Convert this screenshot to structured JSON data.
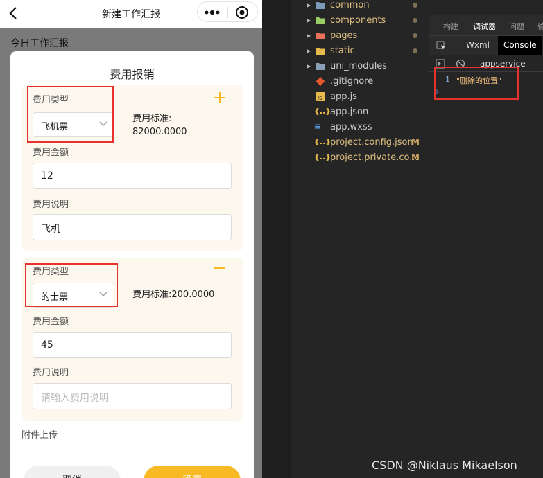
{
  "phone": {
    "nav_title": "新建工作汇报",
    "behind_title": "今日工作汇报",
    "modal": {
      "title": "费用报销",
      "items": [
        {
          "type_label": "费用类型",
          "type_value": "飞机票",
          "standard_label": "费用标准:",
          "standard_value": "82000.0000",
          "amount_label": "费用金额",
          "amount_value": "12",
          "desc_label": "费用说明",
          "desc_value": "飞机",
          "action_icon": "plus-icon"
        },
        {
          "type_label": "费用类型",
          "type_value": "的士票",
          "standard_text": "费用标准:200.0000",
          "amount_label": "费用金额",
          "amount_value": "45",
          "desc_label": "费用说明",
          "desc_placeholder": "请输入费用说明",
          "action_icon": "minus-icon"
        }
      ],
      "attach_label": "附件上传",
      "cancel_label": "取消",
      "confirm_label": "确定"
    }
  },
  "explorer": {
    "items": [
      {
        "name": "common",
        "kind": "folder",
        "color": "#7d9bb8"
      },
      {
        "name": "components",
        "kind": "folder",
        "color": "#9ccc65"
      },
      {
        "name": "pages",
        "kind": "folder",
        "color": "#e8705a"
      },
      {
        "name": "static",
        "kind": "folder",
        "color": "#e5b94a"
      },
      {
        "name": "uni_modules",
        "kind": "folder",
        "color": "#8aa0b4"
      },
      {
        "name": ".gitignore",
        "kind": "file",
        "icon": "git-icon"
      },
      {
        "name": "app.js",
        "kind": "file",
        "icon": "js-icon"
      },
      {
        "name": "app.json",
        "kind": "file",
        "icon": "json-icon"
      },
      {
        "name": "app.wxss",
        "kind": "file",
        "icon": "css-icon"
      },
      {
        "name": "project.config.json",
        "kind": "file",
        "icon": "json-icon",
        "badge": "M"
      },
      {
        "name": "project.private.co...",
        "kind": "file",
        "icon": "json-icon",
        "badge": "M"
      }
    ]
  },
  "devtools": {
    "tabs": [
      "构建",
      "调试器",
      "问题",
      "输"
    ],
    "active_tab": "调试器",
    "subtabs": [
      "Wxml",
      "Console"
    ],
    "active_subtab": "Console",
    "context": "appservice",
    "console_line_no": "1",
    "console_output": "\"删除的位置\"",
    "prompt": "›"
  },
  "watermark": "CSDN @Niklaus Mikaelson",
  "colors": {
    "accent": "#f7b924",
    "highlight_border": "#e8322e",
    "card_bg": "#fdf8ee"
  }
}
